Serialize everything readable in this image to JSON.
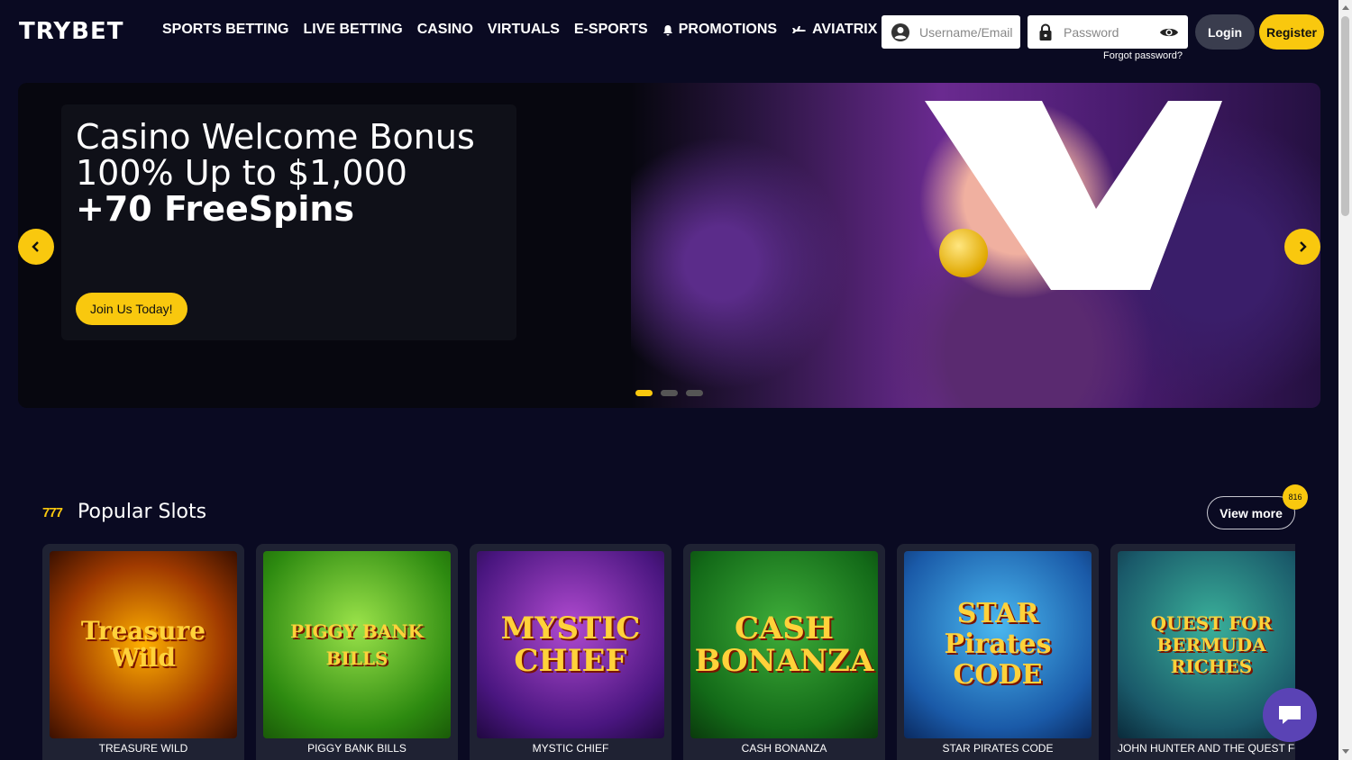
{
  "header": {
    "logo": "TRYBET",
    "nav": [
      {
        "label": "SPORTS BETTING",
        "icon": ""
      },
      {
        "label": "LIVE BETTING",
        "icon": ""
      },
      {
        "label": "CASINO",
        "icon": ""
      },
      {
        "label": "VIRTUALS",
        "icon": ""
      },
      {
        "label": "E-SPORTS",
        "icon": ""
      },
      {
        "label": "PROMOTIONS",
        "icon": "bell-icon"
      },
      {
        "label": "AVIATRIX",
        "icon": "plane-icon"
      }
    ],
    "username_placeholder": "Username/Email",
    "password_placeholder": "Password",
    "forgot_password": "Forgot password?",
    "login_label": "Login",
    "register_label": "Register"
  },
  "hero": {
    "title_line1": "Casino Welcome Bonus",
    "title_line2": "100% Up to $1,000",
    "title_line3": "+70 FreeSpins",
    "cta_label": "Join Us Today!",
    "slide_count": 3,
    "active_slide": 1
  },
  "slots": {
    "title": "Popular Slots",
    "view_more_label": "View more",
    "count": "816",
    "games": [
      {
        "name": "TREASURE WILD",
        "art": "Treasure Wild"
      },
      {
        "name": "PIGGY BANK BILLS",
        "art": "PIGGY BANK BILLS"
      },
      {
        "name": "MYSTIC CHIEF",
        "art": "MYSTIC CHIEF"
      },
      {
        "name": "CASH BONANZA",
        "art": "CASH BONANZA"
      },
      {
        "name": "STAR PIRATES CODE",
        "art": "STAR Pirates CODE"
      },
      {
        "name": "JOHN HUNTER AND THE QUEST FOR BERMUDA RICHES",
        "art": "QUEST FOR BERMUDA RICHES"
      }
    ]
  },
  "colors": {
    "background": "#0a0a22",
    "accent": "#f9c80e",
    "card": "#1f2233",
    "chat": "#5a43b5"
  }
}
